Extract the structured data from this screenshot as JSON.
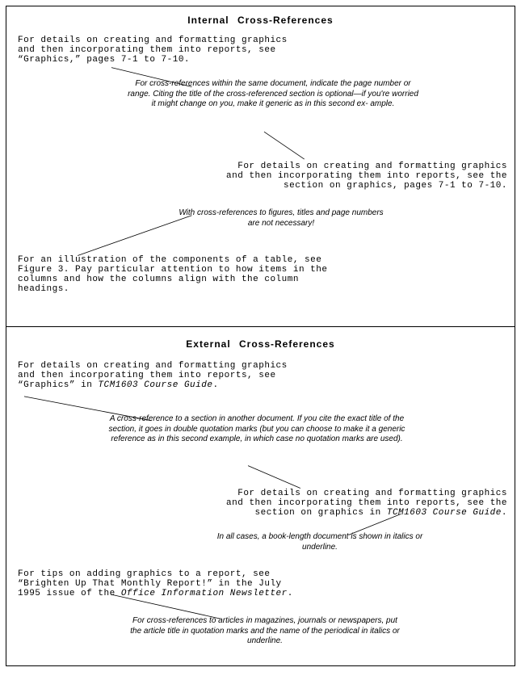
{
  "internal": {
    "title": "Internal  Cross-References",
    "example1": "For details on creating and formatting graphics\nand then incorporating them into reports, see\n“Graphics,” pages 7-1 to 7-10.",
    "anno1": "For cross-references within the same document, indicate the\npage number or range. Citing the title of the\ncross-referenced section is optional—if you're worried it\nmight change on you, make it generic as in this second ex-\nample.",
    "example2": "For details on creating and formatting graphics\nand then incorporating them into reports, see the\nsection on graphics, pages 7-1 to 7-10.",
    "anno2": "With cross-references to figures, titles\nand page numbers are not necessary!",
    "example3": "For an illustration of the components of a table, see\nFigure 3. Pay particular attention to how items in the\ncolumns and how the columns align with the column\nheadings."
  },
  "external": {
    "title": "External  Cross-References",
    "example1_pre": "For details on creating and formatting graphics\nand then incorporating them into reports, see\n“Graphics” in ",
    "example1_ital": "TCM1603 Course Guide",
    "example1_post": ".",
    "anno1": "A cross-reference to a section in another document. If you cite the\nexact title of the section, it goes\nin double quotation marks (but you can choose to make it\na generic reference as in this second example, in which case no\nquotation marks are used).",
    "example2_pre": "For details on creating and formatting graphics\nand then incorporating them into reports, see the\nsection on graphics in ",
    "example2_ital": "TCM1603 Course Guide",
    "example2_post": ".",
    "anno2": "In all cases, a book-length document is shown in\nitalics or underline.",
    "example3_pre": "For tips on adding graphics to a report, see\n“Brighten Up That Monthly Report!” in the July\n1995 issue of the ",
    "example3_ital": "Office Information Newsletter",
    "example3_post": ".",
    "anno3": "For cross-references to articles in magazines, journals or\nnewspapers, put the\narticle title in quotation marks and the name of the\nperiodical in italics or underline."
  }
}
